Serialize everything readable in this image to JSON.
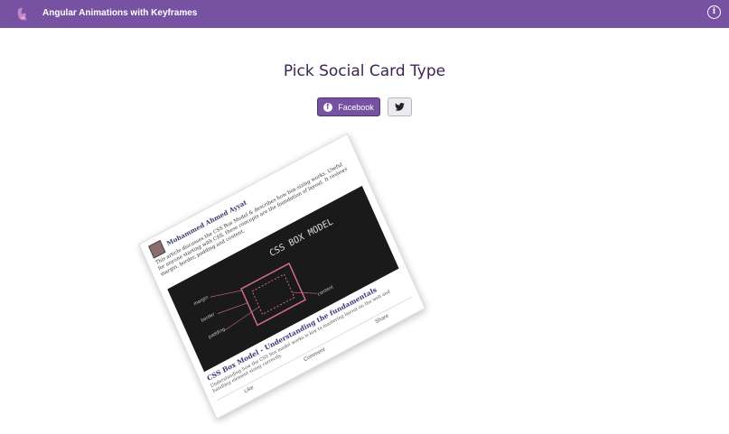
{
  "app": {
    "title": "Angular Animations with Keyframes",
    "accent_color": "#7752a3",
    "logo_icon": "angular-logo-icon",
    "info_icon": "info-icon"
  },
  "main": {
    "heading": "Pick Social Card Type",
    "buttons": [
      {
        "label": "Facebook",
        "icon": "facebook-icon",
        "active": true
      },
      {
        "label": "",
        "icon": "twitter-icon",
        "active": false
      }
    ]
  },
  "card": {
    "author": "Mohammed Ahmed Ayyat",
    "post_text": "This article discusses the CSS Box Model & describes how box-sizing works. Useful for anyone starting with CSS, these concepts are the foundation of layout. It reviews margin, border, padding and content.",
    "image_caption": "CSS BOX MODEL",
    "image_labels": [
      "margin",
      "border",
      "padding",
      "content"
    ],
    "article_title": "CSS Box Model - Understanding the fundamentals",
    "article_desc": "Understanding how the CSS box model works is key to mastering layout on the web and handling element sizing correctly.",
    "actions": [
      "Like",
      "Comment",
      "Share"
    ]
  }
}
